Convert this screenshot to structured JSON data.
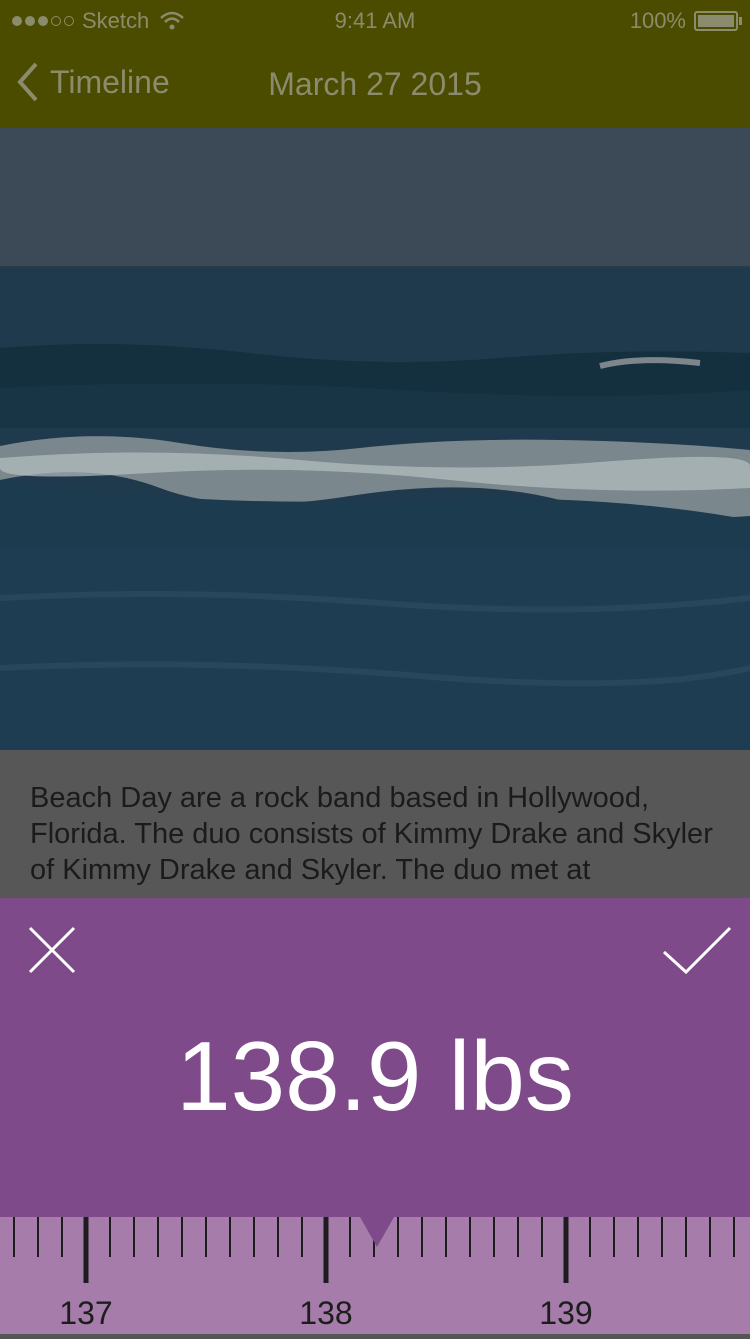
{
  "status_bar": {
    "carrier": "Sketch",
    "time": "9:41 AM",
    "battery": "100%"
  },
  "nav": {
    "back_label": "Timeline",
    "title": "March 27 2015"
  },
  "post": {
    "body": "Beach Day are a rock band based in Hollywood, Florida. The duo consists of Kimmy Drake and Skyler of Kimmy Drake and Skyler. The duo met at"
  },
  "weight_picker": {
    "value_display": "138.9 lbs",
    "current_value": 138.9,
    "ruler_labels": [
      "137",
      "138",
      "139"
    ],
    "colors": {
      "sheet": "#7e4a8a",
      "ruler": "#a67cab"
    }
  },
  "icons": [
    "wifi-icon",
    "battery-icon",
    "back-chevron-icon",
    "close-icon",
    "checkmark-icon",
    "ruler-pointer-icon"
  ]
}
